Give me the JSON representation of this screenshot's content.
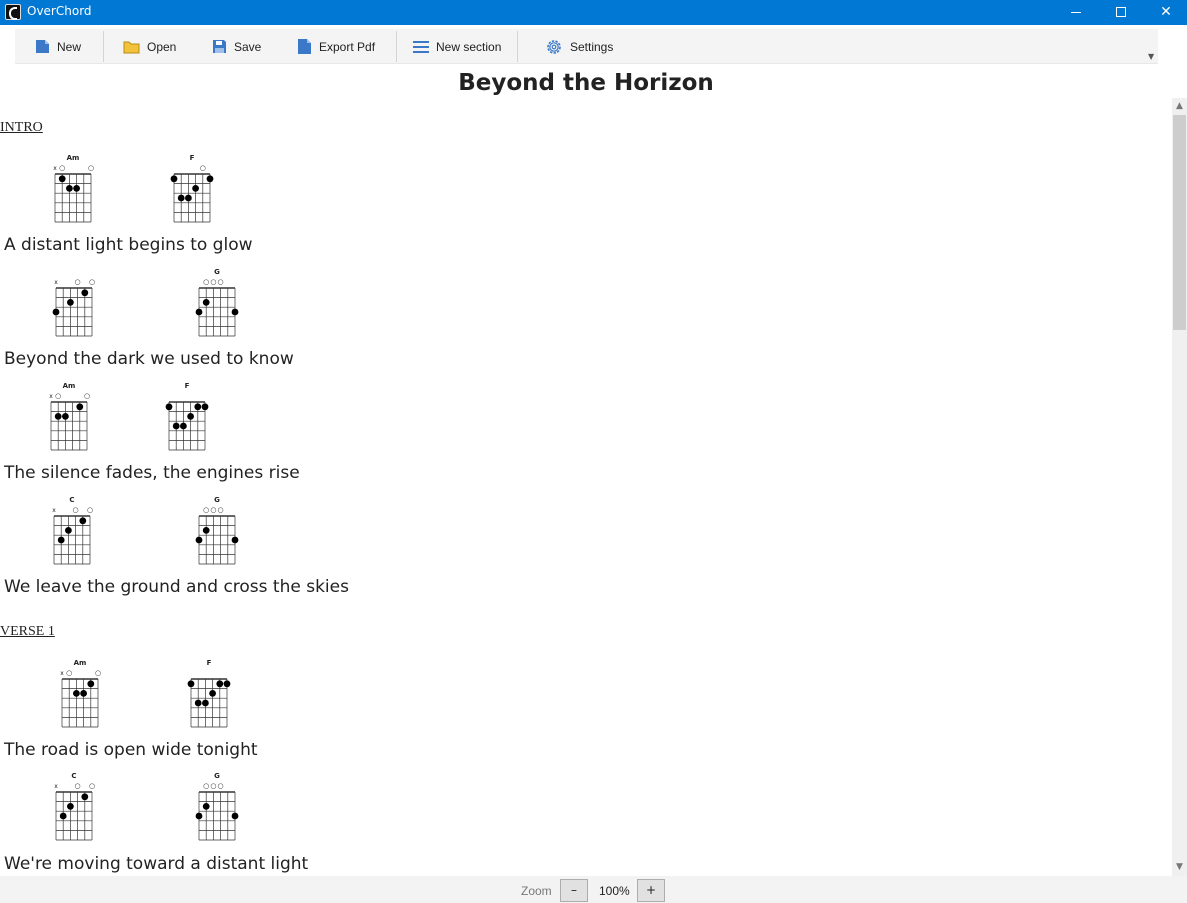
{
  "window": {
    "title": "OverChord",
    "icon": "overchord-logo-icon"
  },
  "toolbar": {
    "items": [
      {
        "label": "New",
        "icon": "new-file-icon"
      },
      {
        "label": "Open",
        "icon": "folder-icon"
      },
      {
        "label": "Save",
        "icon": "save-disk-icon"
      },
      {
        "label": "Export Pdf",
        "icon": "export-pdf-icon"
      },
      {
        "label": "New section",
        "icon": "lines-icon"
      },
      {
        "label": "Settings",
        "icon": "gear-icon"
      }
    ],
    "accent": "#3c78c8"
  },
  "song": {
    "title": "Beyond the Horizon",
    "sections": [
      {
        "label": "INTRO",
        "lines": [
          {
            "chords": [
              {
                "name": "Am",
                "markers": "xo   o",
                "dots": [
                  [
                    2,
                    1
                  ],
                  [
                    3,
                    2
                  ],
                  [
                    4,
                    2
                  ]
                ]
              },
              {
                "name": "F",
                "markers": "    o ",
                "dots": [
                  [
                    1,
                    1
                  ],
                  [
                    6,
                    1
                  ],
                  [
                    4,
                    2
                  ],
                  [
                    2,
                    3
                  ],
                  [
                    3,
                    3
                  ]
                ]
              }
            ],
            "lyric": "A distant light begins to glow"
          },
          {
            "chords": [
              {
                "name": "",
                "markers": "x  o o",
                "dots": [
                  [
                    5,
                    1
                  ],
                  [
                    3,
                    2
                  ],
                  [
                    1,
                    3
                  ]
                ]
              },
              {
                "name": "G",
                "markers": " ooo  ",
                "dots": [
                  [
                    2,
                    2
                  ],
                  [
                    1,
                    3
                  ],
                  [
                    6,
                    3
                  ]
                ]
              }
            ],
            "lyric": "Beyond the dark we used to know"
          },
          {
            "chords": [
              {
                "name": "Am",
                "markers": "xo   o",
                "dots": [
                  [
                    5,
                    1
                  ],
                  [
                    2,
                    2
                  ],
                  [
                    3,
                    2
                  ]
                ]
              },
              {
                "name": "F",
                "markers": "      ",
                "dots": [
                  [
                    1,
                    1
                  ],
                  [
                    5,
                    1
                  ],
                  [
                    6,
                    1
                  ],
                  [
                    4,
                    2
                  ],
                  [
                    2,
                    3
                  ],
                  [
                    3,
                    3
                  ]
                ]
              }
            ],
            "lyric": "The silence fades, the engines rise"
          },
          {
            "chords": [
              {
                "name": "C",
                "markers": "x  o o",
                "dots": [
                  [
                    5,
                    1
                  ],
                  [
                    3,
                    2
                  ],
                  [
                    2,
                    3
                  ]
                ]
              },
              {
                "name": "G",
                "markers": " ooo  ",
                "dots": [
                  [
                    2,
                    2
                  ],
                  [
                    1,
                    3
                  ],
                  [
                    6,
                    3
                  ]
                ]
              }
            ],
            "lyric": "We leave the ground and cross the skies"
          }
        ]
      },
      {
        "label": "VERSE 1",
        "lines": [
          {
            "chords": [
              {
                "name": "Am",
                "markers": "xo   o",
                "dots": [
                  [
                    5,
                    1
                  ],
                  [
                    3,
                    2
                  ],
                  [
                    4,
                    2
                  ]
                ]
              },
              {
                "name": "F",
                "markers": "      ",
                "dots": [
                  [
                    1,
                    1
                  ],
                  [
                    5,
                    1
                  ],
                  [
                    6,
                    1
                  ],
                  [
                    4,
                    2
                  ],
                  [
                    2,
                    3
                  ],
                  [
                    3,
                    3
                  ]
                ]
              }
            ],
            "lyric": "The road is open wide tonight"
          },
          {
            "chords": [
              {
                "name": "C",
                "markers": "x  o o",
                "dots": [
                  [
                    5,
                    1
                  ],
                  [
                    3,
                    2
                  ],
                  [
                    2,
                    3
                  ]
                ]
              },
              {
                "name": "G",
                "markers": " ooo  ",
                "dots": [
                  [
                    2,
                    2
                  ],
                  [
                    1,
                    3
                  ],
                  [
                    6,
                    3
                  ]
                ]
              }
            ],
            "lyric": "We're moving toward a distant light"
          }
        ]
      }
    ]
  },
  "statusbar": {
    "zoom_label": "Zoom",
    "zoom_minus": "–",
    "zoom_value": "100%",
    "zoom_plus": "+"
  }
}
